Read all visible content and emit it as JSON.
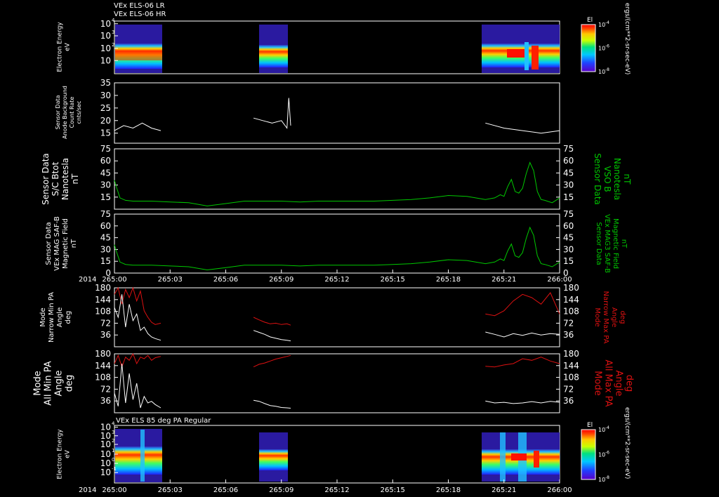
{
  "colors": {
    "background": "#000000",
    "text": "#ffffff",
    "bfield": "#00c800",
    "max_pa": "#dd1111",
    "min_pa": "#ffffff"
  },
  "header": {
    "line1": "VEx ELS-06 LR",
    "line2": "VEx ELS-06 HR"
  },
  "right_unit": "ergs/(cm**2-sr-sec-eV)",
  "time_axis": {
    "year": "2014",
    "ticks": [
      "265:00",
      "265:03",
      "265:06",
      "265:09",
      "265:12",
      "265:15",
      "265:18",
      "265:21",
      "266:00"
    ]
  },
  "panels": {
    "spec1": {
      "ylabel": [
        "Electron Energy",
        "eV"
      ],
      "yticks": [
        "10",
        "10",
        "10",
        "10"
      ],
      "yexp": [
        "4",
        "3",
        "2",
        ""
      ],
      "colorbar": {
        "title": "El",
        "ticks": [
          "10",
          "10",
          "10"
        ],
        "exps": [
          "-4",
          "-6",
          "-8"
        ]
      }
    },
    "bg": {
      "ylabel": [
        "Sensor Data",
        "Anode Background",
        "Count Rate",
        "cnts/sec"
      ],
      "yticks": [
        "35",
        "30",
        "25",
        "20",
        "15"
      ]
    },
    "bmag": {
      "ylabel": [
        "Sensor Data",
        "S/C Btot",
        "Nanotesla",
        "nT"
      ],
      "ylabel_right": [
        "Sensor Data",
        "VSO B",
        "Nanotesla",
        "nT"
      ],
      "yticks": [
        "75",
        "60",
        "45",
        "30",
        "15"
      ]
    },
    "mag": {
      "ylabel": [
        "Sensor Data",
        "VEx MAG SAF-B",
        "Magnetic Field",
        "nT"
      ],
      "ylabel_right": [
        "Sensor Data",
        "VEx MAG3 SAF-B",
        "Magnetic Field",
        "nT"
      ],
      "yticks": [
        "75",
        "60",
        "45",
        "30",
        "15",
        "0"
      ]
    },
    "pa_narrow": {
      "ylabel": [
        "Mode",
        "Narrow Min PA",
        "Angle",
        "deg"
      ],
      "ylabel_right": [
        "Mode",
        "Narrow Max PA",
        "Angle",
        "deg"
      ],
      "yticks": [
        "180",
        "144",
        "108",
        "72",
        "36"
      ]
    },
    "pa_all": {
      "ylabel": [
        "Mode",
        "All Min PA",
        "Angle",
        "deg"
      ],
      "ylabel_right": [
        "Mode",
        "All Max PA",
        "Angle",
        "deg"
      ],
      "yticks": [
        "180",
        "144",
        "108",
        "72",
        "36"
      ]
    },
    "spec2": {
      "title": "VEx ELS 85 deg PA Regular",
      "ylabel": [
        "Electron Energy",
        "eV"
      ],
      "yticks": [
        "10",
        "10",
        "10",
        "10",
        "10",
        "10"
      ],
      "yexp": [
        "4",
        "3",
        "2",
        "1",
        "0",
        "-1"
      ],
      "colorbar": {
        "title": "El",
        "ticks": [
          "10",
          "10",
          "10"
        ],
        "exps": [
          "-4",
          "-6",
          "-8"
        ]
      }
    }
  },
  "chart_data": [
    {
      "type": "heatmap",
      "title": "VEx ELS-06 LR / VEx ELS-06 HR",
      "ylabel": "Electron Energy eV",
      "scale": "log",
      "x_range": [
        "265:00",
        "266:00"
      ],
      "data_intervals": [
        [
          "265:00",
          "265:02.5"
        ],
        [
          "265:07.5",
          "265:09.5"
        ],
        [
          "265:20",
          "266:00"
        ]
      ]
    },
    {
      "type": "line",
      "ylabel": "Sensor Data Anode Background Count Rate cnts/sec",
      "ylim": [
        11,
        35
      ],
      "series": [
        {
          "x": [
            0,
            0.5,
            1,
            1.5,
            2,
            2.5,
            7.5,
            8,
            8.5,
            9,
            9.3,
            9.4,
            9.5,
            20,
            21,
            22,
            23,
            24
          ],
          "y": [
            16,
            18,
            17,
            19,
            17,
            16,
            21,
            20,
            19,
            20,
            17,
            29,
            18,
            19,
            17,
            16,
            15,
            16
          ]
        }
      ]
    },
    {
      "type": "line",
      "ylabel": "Sensor Data S/C Btot Nanotesla nT",
      "ylim": [
        0,
        75
      ],
      "x": [
        0,
        0.1,
        0.3,
        0.6,
        1,
        2,
        3,
        4,
        5,
        6,
        7,
        8,
        9,
        10,
        11,
        12,
        13,
        14,
        15,
        16,
        17,
        18,
        19,
        20,
        20.5,
        20.8,
        21,
        21.2,
        21.4,
        21.6,
        21.8,
        22,
        22.2,
        22.4,
        22.6,
        22.8,
        23,
        23.2,
        23.6,
        24
      ],
      "series": [
        {
          "y": [
            36,
            28,
            14,
            11,
            10,
            10,
            9,
            8,
            4,
            7,
            10,
            10,
            10,
            9,
            10,
            10,
            10,
            10,
            11,
            12,
            14,
            17,
            16,
            12,
            14,
            18,
            16,
            28,
            37,
            22,
            20,
            26,
            44,
            58,
            48,
            22,
            12,
            11,
            8,
            14
          ]
        }
      ]
    },
    {
      "type": "line",
      "ylabel": "Sensor Data VEx MAG SAF-B Magnetic Field nT",
      "ylim": [
        0,
        75
      ],
      "x": [
        0,
        0.1,
        0.3,
        0.6,
        1,
        2,
        3,
        4,
        5,
        6,
        7,
        8,
        9,
        10,
        11,
        12,
        13,
        14,
        15,
        16,
        17,
        18,
        19,
        20,
        20.5,
        20.8,
        21,
        21.2,
        21.4,
        21.6,
        21.8,
        22,
        22.2,
        22.4,
        22.6,
        22.8,
        23,
        23.2,
        23.6,
        24
      ],
      "series": [
        {
          "y": [
            36,
            28,
            14,
            11,
            10,
            10,
            9,
            8,
            4,
            7,
            10,
            10,
            10,
            9,
            10,
            10,
            10,
            10,
            11,
            12,
            14,
            17,
            16,
            12,
            14,
            18,
            16,
            28,
            37,
            22,
            20,
            26,
            44,
            58,
            48,
            22,
            12,
            11,
            8,
            14
          ]
        }
      ]
    },
    {
      "type": "line",
      "ylabel": "Mode Narrow Min PA / Max PA Angle deg",
      "ylim": [
        0,
        180
      ],
      "series": [
        {
          "name": "Max PA",
          "segments": [
            {
              "x": [
                0,
                0.2,
                0.4,
                0.6,
                0.8,
                1.0,
                1.2,
                1.4,
                1.6,
                1.8,
                2.0,
                2.2,
                2.5
              ],
              "y": [
                160,
                180,
                130,
                175,
                150,
                180,
                140,
                170,
                110,
                90,
                75,
                68,
                72
              ]
            },
            {
              "x": [
                7.5,
                7.8,
                8.1,
                8.4,
                8.7,
                9.0,
                9.3,
                9.5
              ],
              "y": [
                90,
                82,
                75,
                70,
                72,
                68,
                70,
                66
              ]
            },
            {
              "x": [
                20,
                20.5,
                21,
                21.5,
                22,
                22.5,
                23,
                23.5,
                24
              ],
              "y": [
                100,
                95,
                110,
                140,
                160,
                150,
                130,
                165,
                100
              ]
            }
          ]
        },
        {
          "name": "Min PA",
          "segments": [
            {
              "x": [
                0,
                0.2,
                0.4,
                0.6,
                0.8,
                1.0,
                1.2,
                1.4,
                1.6,
                1.8,
                2.0,
                2.2,
                2.5
              ],
              "y": [
                120,
                90,
                160,
                60,
                130,
                80,
                100,
                50,
                60,
                40,
                30,
                25,
                20
              ]
            },
            {
              "x": [
                7.5,
                7.8,
                8.1,
                8.4,
                8.7,
                9.0,
                9.3,
                9.5
              ],
              "y": [
                50,
                44,
                38,
                30,
                26,
                22,
                20,
                18
              ]
            },
            {
              "x": [
                20,
                20.5,
                21,
                21.5,
                22,
                22.5,
                23,
                23.5,
                24
              ],
              "y": [
                45,
                38,
                30,
                40,
                35,
                42,
                36,
                40,
                38
              ]
            }
          ]
        }
      ]
    },
    {
      "type": "line",
      "ylabel": "Mode All Min PA / Max PA Angle deg",
      "ylim": [
        0,
        180
      ],
      "series": [
        {
          "name": "Max PA",
          "segments": [
            {
              "x": [
                0,
                0.2,
                0.4,
                0.6,
                0.8,
                1.0,
                1.2,
                1.4,
                1.6,
                1.8,
                2.0,
                2.2,
                2.5
              ],
              "y": [
                150,
                175,
                140,
                170,
                160,
                180,
                150,
                170,
                165,
                175,
                160,
                168,
                172
              ]
            },
            {
              "x": [
                7.5,
                7.8,
                8.1,
                8.4,
                8.7,
                9.0,
                9.3,
                9.5
              ],
              "y": [
                140,
                148,
                152,
                158,
                164,
                168,
                172,
                175
              ]
            },
            {
              "x": [
                20,
                20.5,
                21,
                21.5,
                22,
                22.5,
                23,
                23.5,
                24
              ],
              "y": [
                142,
                140,
                146,
                150,
                165,
                160,
                170,
                158,
                150
              ]
            }
          ]
        },
        {
          "name": "Min PA",
          "segments": [
            {
              "x": [
                0,
                0.2,
                0.4,
                0.6,
                0.8,
                1.0,
                1.2,
                1.4,
                1.6,
                1.8,
                2.0,
                2.2,
                2.5
              ],
              "y": [
                60,
                20,
                150,
                30,
                120,
                40,
                90,
                15,
                50,
                30,
                35,
                25,
                15
              ]
            },
            {
              "x": [
                7.5,
                7.8,
                8.1,
                8.4,
                8.7,
                9.0,
                9.3,
                9.5
              ],
              "y": [
                38,
                35,
                28,
                22,
                20,
                16,
                15,
                14
              ]
            },
            {
              "x": [
                20,
                20.5,
                21,
                21.5,
                22,
                22.5,
                23,
                23.5,
                24
              ],
              "y": [
                36,
                30,
                32,
                28,
                30,
                34,
                30,
                35,
                32
              ]
            }
          ]
        }
      ]
    },
    {
      "type": "heatmap",
      "title": "VEx ELS 85 deg PA Regular",
      "ylabel": "Electron Energy eV",
      "scale": "log",
      "x_range": [
        "265:00",
        "266:00"
      ],
      "data_intervals": [
        [
          "265:00",
          "265:02.5"
        ],
        [
          "265:07.5",
          "265:09.5"
        ],
        [
          "265:20",
          "266:00"
        ]
      ]
    }
  ]
}
